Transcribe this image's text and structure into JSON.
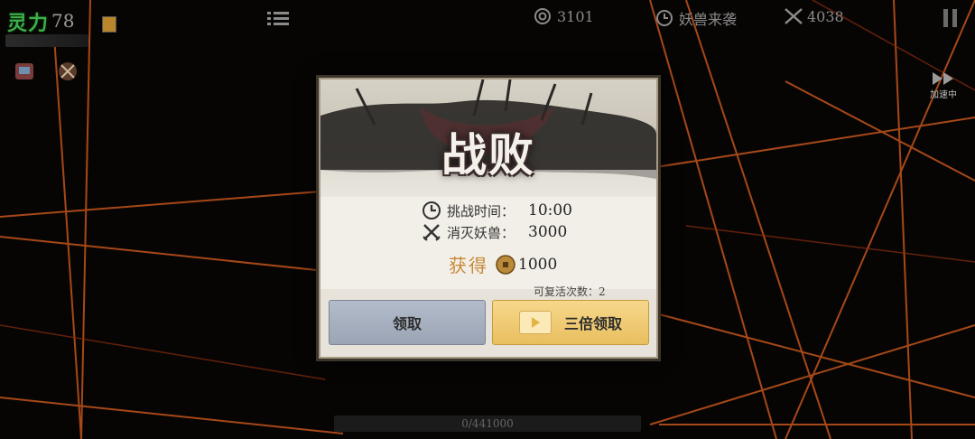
{
  "hud": {
    "hp_label": "灵力",
    "hp_value": "78",
    "coins": "3101",
    "wave_label": "妖兽来袭",
    "kills": "4038",
    "speed_label": "加速中",
    "progress_text": "0/441000"
  },
  "dialog": {
    "title": "战败",
    "time_label": "挑战时间：",
    "time_value": "10:00",
    "kill_label": "消灭妖兽：",
    "kill_value": "3000",
    "reward_label": "获得",
    "reward_value": "1000",
    "revive_text": "可复活次数：2",
    "claim_label": "领取",
    "triple_label": "三倍领取"
  },
  "icons": {
    "clock": "clock-icon",
    "swords": "crossed-swords-icon",
    "coin": "coin-icon",
    "play": "play-icon",
    "pause": "pause-icon",
    "menu": "menu-icon",
    "fast_forward": "fast-forward-icon"
  },
  "colors": {
    "accent_orange": "#c88838",
    "hp_green": "#3fae4a",
    "claim_button": "#a8b1c0",
    "triple_button": "#efcb72"
  }
}
